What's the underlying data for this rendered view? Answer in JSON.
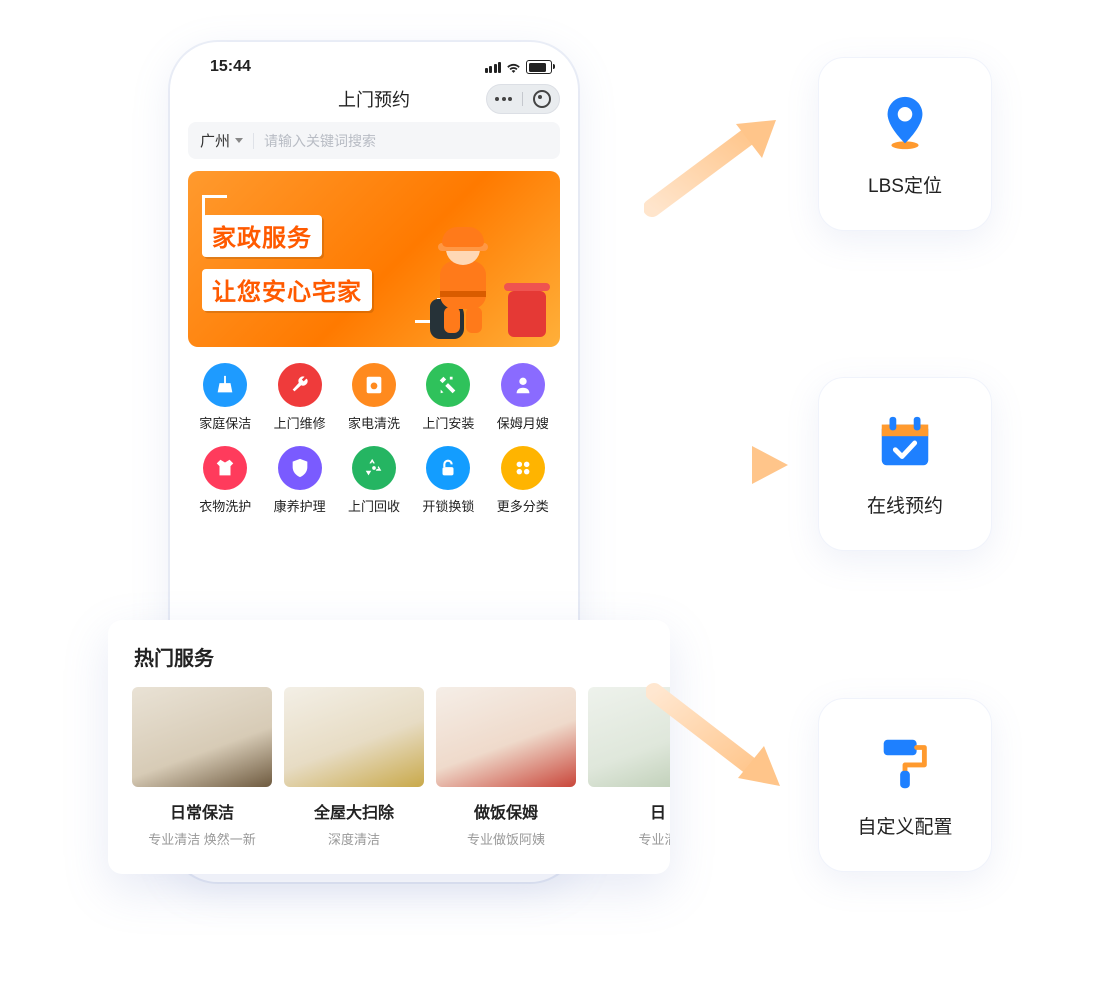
{
  "status": {
    "time": "15:44"
  },
  "header": {
    "title": "上门预约"
  },
  "search": {
    "city": "广州",
    "placeholder": "请输入关键词搜索"
  },
  "banner": {
    "line1": "家政服务",
    "line2": "让您安心宅家"
  },
  "categories": [
    {
      "label": "家庭保洁",
      "color": "#1e9bff",
      "icon": "broom"
    },
    {
      "label": "上门维修",
      "color": "#ef3b3b",
      "icon": "wrench"
    },
    {
      "label": "家电清洗",
      "color": "#ff8a1e",
      "icon": "washer"
    },
    {
      "label": "上门安装",
      "color": "#2fc25b",
      "icon": "tools"
    },
    {
      "label": "保姆月嫂",
      "color": "#8a6bff",
      "icon": "nanny"
    },
    {
      "label": "衣物洗护",
      "color": "#ff3b5c",
      "icon": "shirt"
    },
    {
      "label": "康养护理",
      "color": "#7a5bff",
      "icon": "shield-plus"
    },
    {
      "label": "上门回收",
      "color": "#25b562",
      "icon": "recycle"
    },
    {
      "label": "开锁换锁",
      "color": "#139dff",
      "icon": "lock"
    },
    {
      "label": "更多分类",
      "color": "#ffb400",
      "icon": "more"
    }
  ],
  "popular": {
    "title": "热门服务",
    "items": [
      {
        "name": "日常保洁",
        "sub": "专业清洁 焕然一新"
      },
      {
        "name": "全屋大扫除",
        "sub": "深度清洁"
      },
      {
        "name": "做饭保姆",
        "sub": "专业做饭阿姨"
      },
      {
        "name": "日",
        "sub": "专业清"
      }
    ]
  },
  "features": [
    {
      "label": "LBS定位",
      "icon": "pin"
    },
    {
      "label": "在线预约",
      "icon": "calendar-check"
    },
    {
      "label": "自定义配置",
      "icon": "paint-roller"
    }
  ]
}
